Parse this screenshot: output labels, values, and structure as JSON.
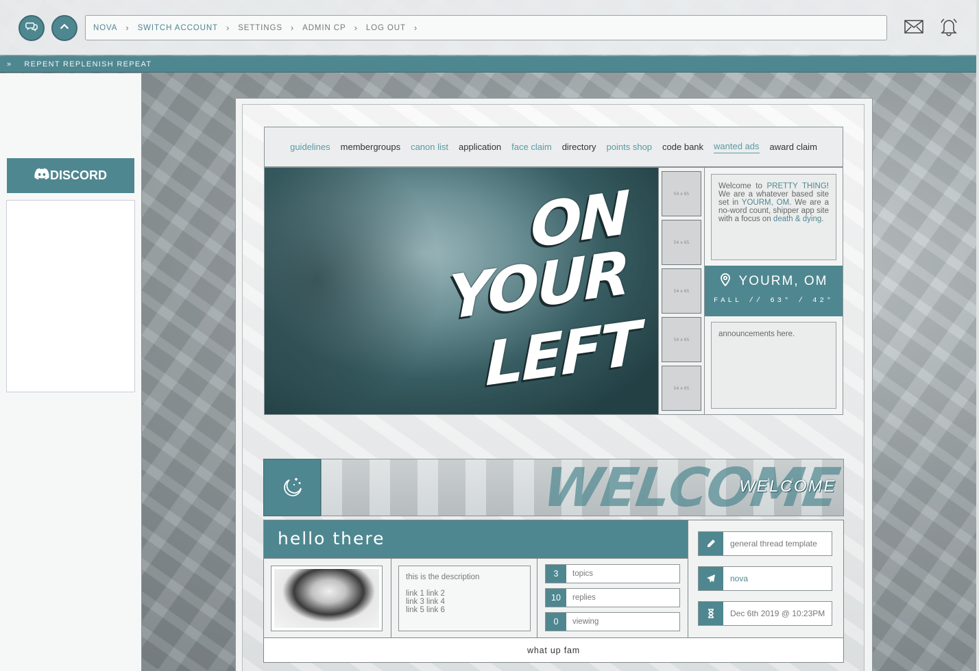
{
  "topbar": {
    "buttons": [
      {
        "icon": "chat-bubbles-icon"
      },
      {
        "icon": "chevron-up-icon"
      }
    ],
    "breadcrumb": [
      "NOVA",
      "SWITCH ACCOUNT",
      "SETTINGS",
      "ADMIN CP",
      "LOG OUT"
    ],
    "breadcrumb_separator": "›",
    "icons": [
      "mail-icon",
      "bell-icon"
    ]
  },
  "ticker": {
    "marker": "»",
    "text": "REPENT REPLENISH REPEAT"
  },
  "sidebar": {
    "discord_label": "DISCORD"
  },
  "nav": {
    "links": [
      "guidelines",
      "membergroups",
      "canon list",
      "application",
      "face claim",
      "directory",
      "points shop",
      "code bank",
      "wanted ads",
      "award claim"
    ]
  },
  "hero": {
    "words": [
      "ON",
      "YOUR",
      "LEFT"
    ]
  },
  "thumbs": {
    "label": "54 x 65"
  },
  "welcome": {
    "w1": "Welcome to",
    "site": "PRETTY THING",
    "w2": "! We are a whatever based site set in",
    "place": "YOURM, OM",
    "w3": ". We are a no-word count, shipper app site with a focus on",
    "focus": "death & dying",
    "w4": "."
  },
  "location": {
    "title": "YOURM, OM",
    "weather": "FALL // 63° / 42°"
  },
  "announcements": "announcements here.",
  "banner": {
    "big": "WELCOME",
    "small": "WELCOME"
  },
  "forum": {
    "title": "hello there",
    "description": "this is the description",
    "links": [
      "link 1 link 2",
      "link 3 link 4",
      "link 5 link 6"
    ],
    "stats": [
      {
        "value": "3",
        "label": "topics"
      },
      {
        "value": "10",
        "label": "replies"
      },
      {
        "value": "0",
        "label": "viewing"
      }
    ],
    "last_topic": "general thread template",
    "last_poster": "nova",
    "last_date": "Dec 6th 2019 @ 10:23PM",
    "footer": "what up fam"
  },
  "colors": {
    "accent": "#4f8790",
    "link_accent": "#5b9aa2"
  }
}
